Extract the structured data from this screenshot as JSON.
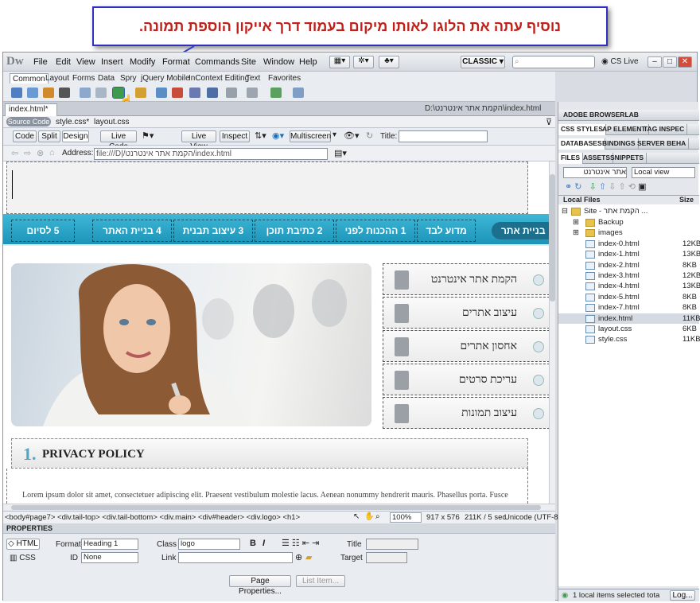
{
  "callout": {
    "text": "נוסיף עתה את הלוגו לאותו מיקום בעמוד דרך אייקון הוספת תמונה."
  },
  "menubar": {
    "logo": "Dw",
    "items": [
      "File",
      "Edit",
      "View",
      "Insert",
      "Modify",
      "Format",
      "Commands",
      "Site",
      "Window",
      "Help"
    ],
    "workspace": "CLASSIC",
    "cslive": "CS Live"
  },
  "insert_tabs": [
    "Common",
    "Layout",
    "Forms",
    "Data",
    "Spry",
    "jQuery Mobile",
    "InContext Editing",
    "Text",
    "Favorites"
  ],
  "document": {
    "tab": "index.html*",
    "path": "D:\\הקמת אתר אינטרנט\\index.html",
    "related": {
      "source": "Source Code",
      "files": [
        "style.css*",
        "layout.css"
      ]
    },
    "view_buttons": [
      "Code",
      "Split",
      "Design"
    ],
    "tool_buttons": [
      "Live Code",
      "Live View",
      "Inspect",
      "Multiscreen"
    ],
    "title_label": "Title:",
    "address_label": "Address:",
    "address_value": "file:///D|/הקמת אתר אינטרנט/index.html"
  },
  "page": {
    "nav": [
      "5 לסיום",
      "4 בניית האתר",
      "3 עיצוב תבנית",
      "2 כתיבת תוכן",
      "1 ההכנות לפני",
      "מדוע לבד"
    ],
    "nav_active": "בניית אתר",
    "services": [
      "הקמת אתר אינטרנט",
      "עיצוב אתרים",
      "אחסון אתרים",
      "עריכת סרטים",
      "עיצוב תמונות"
    ],
    "policy_num": "1.",
    "policy_title": "PRIVACY POLICY",
    "lorem": "Lorem ipsum dolor sit amet, consectetuer adipiscing elit. Praesent vestibulum molestie lacus. Aenean nonummy hendrerit mauris. Phasellus porta. Fusce"
  },
  "statusbar": {
    "tags": "<body#page7> <div.tail-top> <div.tail-bottom> <div.main> <div#header> <div.logo> <h1>",
    "zoom": "100%",
    "size": "917 x 576",
    "weight": "211K / 5 sec",
    "encoding": "Unicode (UTF-8"
  },
  "properties": {
    "header": "PROPERTIES",
    "html": "HTML",
    "css": "CSS",
    "format_label": "Format",
    "format_value": "Heading 1",
    "id_label": "ID",
    "id_value": "None",
    "class_label": "Class",
    "class_value": "logo",
    "link_label": "Link",
    "title_label": "Title",
    "target_label": "Target",
    "b": "B",
    "i": "I",
    "page_props": "Page Properties...",
    "list_item": "List Item..."
  },
  "panels": {
    "browserlab": "ADOBE BROWSERLAB",
    "css_tabs": [
      "CSS STYLES",
      "AP ELEMENT",
      "TAG INSPEC"
    ],
    "db_tabs": [
      "DATABASES",
      "BINDINGS",
      "SERVER BEHA"
    ],
    "file_tabs": [
      "FILES",
      "ASSETS",
      "SNIPPETS"
    ],
    "site_select": "אתר אינטרנט",
    "view_select": "Local view",
    "col_local": "Local Files",
    "col_size": "Size",
    "site_root": "Site - הקמת אתר ...",
    "files": [
      {
        "name": "Backup",
        "size": "",
        "type": "folder"
      },
      {
        "name": "images",
        "size": "",
        "type": "folder"
      },
      {
        "name": "index-0.html",
        "size": "12KB",
        "type": "file"
      },
      {
        "name": "index-1.html",
        "size": "13KB",
        "type": "file"
      },
      {
        "name": "index-2.html",
        "size": "8KB",
        "type": "file"
      },
      {
        "name": "index-3.html",
        "size": "12KB",
        "type": "file"
      },
      {
        "name": "index-4.html",
        "size": "13KB",
        "type": "file"
      },
      {
        "name": "index-5.html",
        "size": "8KB",
        "type": "file"
      },
      {
        "name": "index-7.html",
        "size": "8KB",
        "type": "file"
      },
      {
        "name": "index.html",
        "size": "11KB",
        "type": "file"
      },
      {
        "name": "layout.css",
        "size": "6KB",
        "type": "file"
      },
      {
        "name": "style.css",
        "size": "11KB",
        "type": "file"
      }
    ],
    "status": "1 local items selected tota",
    "log": "Log..."
  },
  "colors": {
    "nav": "#1b94b8",
    "accent": "#4aa9c8",
    "callout_text": "#c0201a",
    "callout_border": "#2f2fc0"
  }
}
